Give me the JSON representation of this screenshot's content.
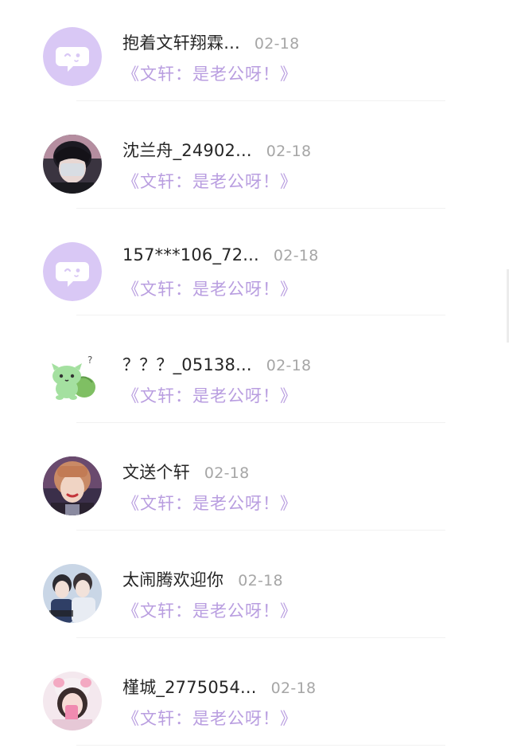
{
  "colors": {
    "name": "#262626",
    "time": "#a6a6a6",
    "message": "#b99ee0",
    "default_avatar": "#d9c8f5"
  },
  "conversations": [
    {
      "name": "抱着文轩翔霖...",
      "time": "02-18",
      "message": "《文轩：是老公呀！》",
      "avatar": "default-chat-icon"
    },
    {
      "name": "沈兰舟_24902...",
      "time": "02-18",
      "message": "《文轩：是老公呀！》",
      "avatar": "photo"
    },
    {
      "name": "157***106_72...",
      "time": "02-18",
      "message": "《文轩：是老公呀！》",
      "avatar": "default-chat-icon"
    },
    {
      "name": "？？？_05138...",
      "time": "02-18",
      "message": "《文轩：是老公呀！》",
      "avatar": "green-creature"
    },
    {
      "name": "文送个轩",
      "time": "02-18",
      "message": "《文轩：是老公呀！》",
      "avatar": "photo"
    },
    {
      "name": "太闹腾欢迎你",
      "time": "02-18",
      "message": "《文轩：是老公呀！》",
      "avatar": "photo"
    },
    {
      "name": "槿城_2775054...",
      "time": "02-18",
      "message": "《文轩：是老公呀！》",
      "avatar": "photo"
    }
  ]
}
